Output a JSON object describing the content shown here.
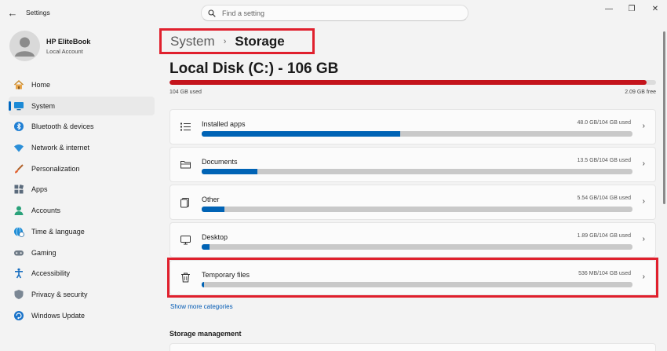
{
  "window": {
    "title": "Settings",
    "back_icon": "arrow-left-icon",
    "controls": [
      "minimize-icon",
      "restore-icon",
      "close-icon"
    ]
  },
  "search": {
    "placeholder": "Find a setting",
    "value": ""
  },
  "profile": {
    "name": "HP EliteBook",
    "account_type": "Local Account"
  },
  "sidebar": {
    "items": [
      {
        "label": "Home",
        "icon": "home-icon"
      },
      {
        "label": "System",
        "icon": "monitor-icon",
        "active": true
      },
      {
        "label": "Bluetooth & devices",
        "icon": "bluetooth-icon"
      },
      {
        "label": "Network & internet",
        "icon": "wifi-icon"
      },
      {
        "label": "Personalization",
        "icon": "brush-icon"
      },
      {
        "label": "Apps",
        "icon": "apps-icon"
      },
      {
        "label": "Accounts",
        "icon": "person-icon"
      },
      {
        "label": "Time & language",
        "icon": "globe-clock-icon"
      },
      {
        "label": "Gaming",
        "icon": "gamepad-icon"
      },
      {
        "label": "Accessibility",
        "icon": "accessibility-icon"
      },
      {
        "label": "Privacy & security",
        "icon": "shield-icon"
      },
      {
        "label": "Windows Update",
        "icon": "update-icon"
      }
    ]
  },
  "breadcrumb": {
    "parent": "System",
    "separator": "›",
    "current": "Storage"
  },
  "disk": {
    "title": "Local Disk (C:) - 106 GB",
    "used_label": "104 GB used",
    "free_label": "2.09 GB free",
    "used_fraction": 0.98
  },
  "categories": [
    {
      "name": "Installed apps",
      "usage": "48.0 GB/104 GB used",
      "fraction": 0.46,
      "icon": "list-icon"
    },
    {
      "name": "Documents",
      "usage": "13.5 GB/104 GB used",
      "fraction": 0.13,
      "icon": "folder-icon"
    },
    {
      "name": "Other",
      "usage": "5.54 GB/104 GB used",
      "fraction": 0.053,
      "icon": "files-icon"
    },
    {
      "name": "Desktop",
      "usage": "1.89 GB/104 GB used",
      "fraction": 0.018,
      "icon": "desktop-icon"
    },
    {
      "name": "Temporary files",
      "usage": "536 MB/104 GB used",
      "fraction": 0.005,
      "icon": "trash-icon"
    }
  ],
  "show_more": "Show more categories",
  "storage_management": {
    "heading": "Storage management"
  },
  "colors": {
    "accent": "#0067c0",
    "disk_bar": "#c4141c",
    "category_bar": "#0063b5",
    "highlight": "#e0202d"
  }
}
